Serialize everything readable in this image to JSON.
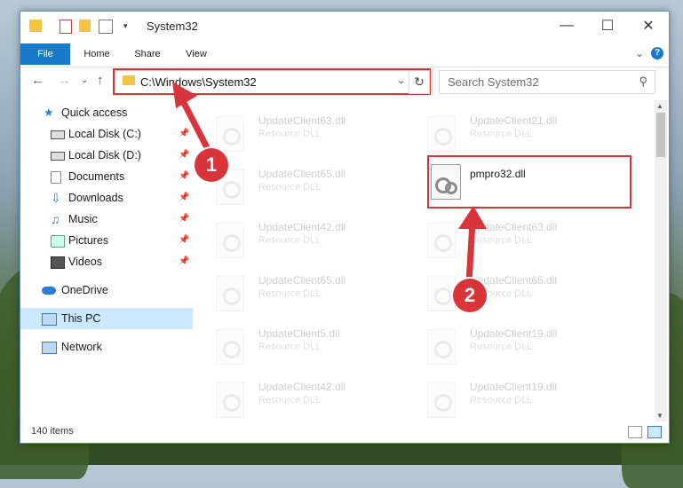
{
  "window": {
    "title": "System32"
  },
  "ribbon": {
    "tabs": [
      {
        "label": "File"
      },
      {
        "label": "Home"
      },
      {
        "label": "Share"
      },
      {
        "label": "View"
      }
    ]
  },
  "address": {
    "path": "C:\\Windows\\System32"
  },
  "search": {
    "placeholder": "Search System32"
  },
  "sidebar": {
    "items": [
      {
        "label": "Quick access"
      },
      {
        "label": "Local Disk (C:)"
      },
      {
        "label": "Local Disk (D:)"
      },
      {
        "label": "Documents"
      },
      {
        "label": "Downloads"
      },
      {
        "label": "Music"
      },
      {
        "label": "Pictures"
      },
      {
        "label": "Videos"
      },
      {
        "label": "OneDrive"
      },
      {
        "label": "This PC"
      },
      {
        "label": "Network"
      }
    ]
  },
  "files": {
    "left": [
      {
        "name": "UpdateClient63.dll",
        "desc": "Resource DLL"
      },
      {
        "name": "UpdateClient65.dll",
        "desc": "Resource DLL"
      },
      {
        "name": "UpdateClient42.dll",
        "desc": "Resource DLL"
      },
      {
        "name": "UpdateClient65.dll",
        "desc": "Resource DLL"
      },
      {
        "name": "UpdateClient5.dll",
        "desc": "Resource DLL"
      },
      {
        "name": "UpdateClient42.dll",
        "desc": "Resource DLL"
      }
    ],
    "right": [
      {
        "name": "UpdateClient21.dll",
        "desc": "Resource DLL"
      },
      {
        "name": "pmpro32.dll",
        "desc": ""
      },
      {
        "name": "UpdateClient63.dll",
        "desc": "Resource DLL"
      },
      {
        "name": "UpdateClient65.dll",
        "desc": "Resource DLL"
      },
      {
        "name": "UpdateClient19.dll",
        "desc": "Resource DLL"
      },
      {
        "name": "UpdateClient19.dll",
        "desc": "Resource DLL"
      }
    ]
  },
  "status": {
    "item_count": "140 items"
  },
  "annotations": {
    "step1": "1",
    "step2": "2"
  },
  "colors": {
    "accent": "#1979ca",
    "highlight": "#d9343a",
    "selection": "#cce8ff"
  }
}
